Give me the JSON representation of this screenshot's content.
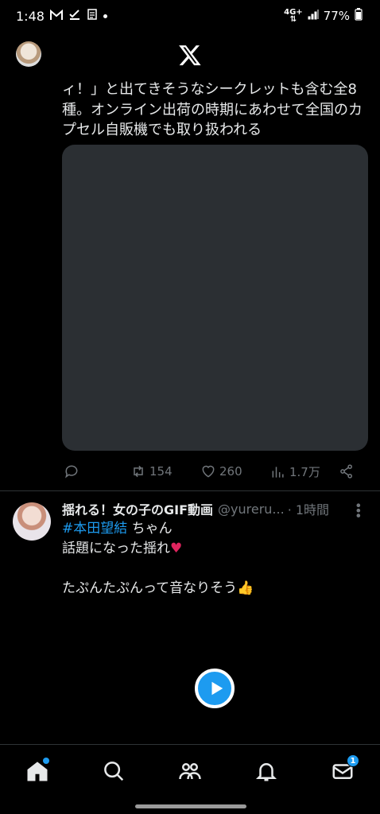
{
  "status": {
    "time": "1:48",
    "network_top": "4G+",
    "battery": "77%"
  },
  "tweet1": {
    "text": "ィ！」と出てきそうなシークレットも含む全8種。オンライン出荷の時期にあわせて全国のカプセル自販機でも取り扱われる",
    "retweets": "154",
    "likes": "260",
    "views": "1.7万"
  },
  "tweet2": {
    "name": "揺れる！女の子のGIF動画",
    "handle": "@yureru...",
    "time": "· 1時間",
    "hashtag": "#本田望結",
    "hashtag_suffix": " ちゃん",
    "line2": "話題になった揺れ",
    "line3": "たぷんたぷんって音なりそう"
  },
  "tabs": {
    "messages_badge": "1"
  },
  "icons": {
    "status_left": [
      "gmail-icon",
      "task-icon",
      "app-icon",
      "dot-icon"
    ],
    "status_right": [
      "signal-icon",
      "battery-icon"
    ],
    "actions": [
      "reply-icon",
      "retweet-icon",
      "like-icon",
      "views-icon",
      "share-icon"
    ],
    "tabbar": [
      "home-icon",
      "search-icon",
      "communities-icon",
      "notifications-icon",
      "messages-icon"
    ]
  },
  "colors": {
    "accent": "#1d9bf0",
    "muted": "#71767b",
    "background": "#000000",
    "media_placeholder": "#2b2f33"
  }
}
